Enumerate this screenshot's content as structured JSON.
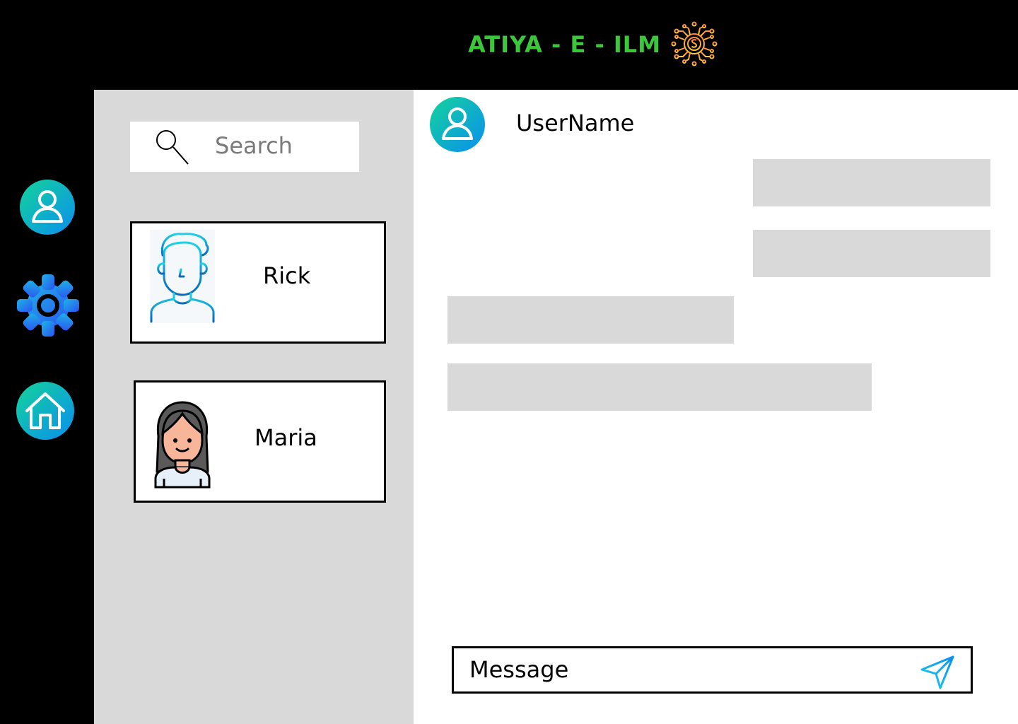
{
  "header": {
    "brand": "ATIYA - E - ILM",
    "logo_icon": "circuit-dollar-icon",
    "brand_color": "#3cc63c"
  },
  "rail": {
    "items": [
      {
        "icon": "profile-icon"
      },
      {
        "icon": "settings-gear-icon"
      },
      {
        "icon": "home-icon"
      }
    ],
    "accent_start": "#14d39a",
    "accent_end": "#0a8fef"
  },
  "search": {
    "placeholder": "Search",
    "icon": "search-icon"
  },
  "contacts": [
    {
      "name": "Rick",
      "icon": "male-avatar-icon"
    },
    {
      "name": "Maria",
      "icon": "female-avatar-icon"
    }
  ],
  "chat": {
    "username": "UserName",
    "avatar_icon": "user-avatar-icon",
    "bubble_color": "#d9d9d9",
    "composer_placeholder": "Message",
    "send_icon": "send-paper-plane-icon"
  }
}
